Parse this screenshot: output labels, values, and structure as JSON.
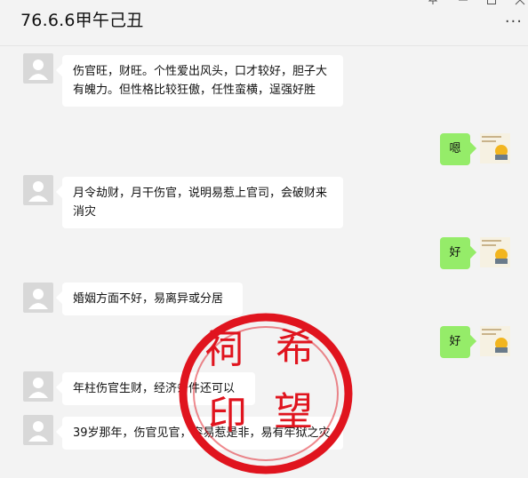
{
  "window": {
    "title": "76.6.6甲午己丑",
    "pin_icon": "pin-icon",
    "minimize_icon": "minimize-icon",
    "maximize_icon": "maximize-icon",
    "close_icon": "close-icon",
    "more_label": "···"
  },
  "messages": [
    {
      "side": "in",
      "text": "伤官旺，财旺。个性爱出风头，口才较好，胆子大有魄力。但性格比较狂傲，任性蛮横，逞强好胜"
    },
    {
      "side": "out",
      "text": "嗯"
    },
    {
      "side": "in",
      "text": "月令劫财，月干伤官，说明易惹上官司，会破财来消灾"
    },
    {
      "side": "out",
      "text": "好"
    },
    {
      "side": "in",
      "text": "婚姻方面不好，易离异或分居"
    },
    {
      "side": "out",
      "text": "好"
    },
    {
      "side": "in",
      "text": "年柱伤官生财，经济条件还可以"
    },
    {
      "side": "in",
      "text": "39岁那年，伤官见官，容易惹是非，易有牢狱之灾"
    }
  ],
  "watermark": {
    "chars": [
      "祠",
      "希",
      "印",
      "望"
    ],
    "color": "#e0141e"
  }
}
